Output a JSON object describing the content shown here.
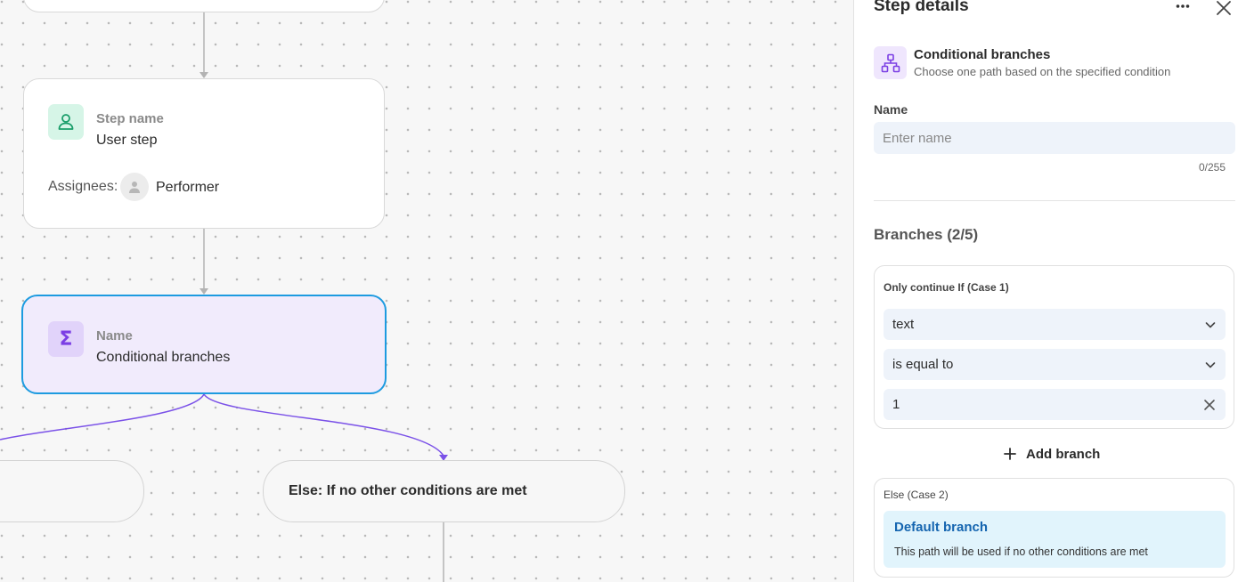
{
  "canvas": {
    "user_step": {
      "label": "Step name",
      "value": "User step",
      "assignees_label": "Assignees:",
      "assignee": "Performer"
    },
    "conditional_step": {
      "label": "Name",
      "value": "Conditional branches"
    },
    "else_branch_label": "Else: If no other conditions are met",
    "colors": {
      "selected_border": "#1d9be0",
      "branch_line": "#7b52e8",
      "user_icon_bg": "#d6f5e7",
      "cond_bg": "#f1ebfc"
    }
  },
  "panel": {
    "title": "Step details",
    "more_icon": "ellipsis-icon",
    "close_icon": "close-icon",
    "step_type": {
      "title": "Conditional branches",
      "description": "Choose one path based on the specified condition",
      "icon": "hierarchy-icon"
    },
    "name_field": {
      "label": "Name",
      "placeholder": "Enter name",
      "value": "",
      "counter": "0/255"
    },
    "branches": {
      "title": "Branches (2/5)",
      "case1": {
        "title": "Only continue If (Case 1)",
        "field": "text",
        "operator": "is equal to",
        "value": "1"
      },
      "add_branch_label": "Add branch",
      "case2": {
        "title": "Else (Case 2)",
        "default_title": "Default branch",
        "default_description": "This path will be used if no other conditions are met"
      }
    }
  }
}
